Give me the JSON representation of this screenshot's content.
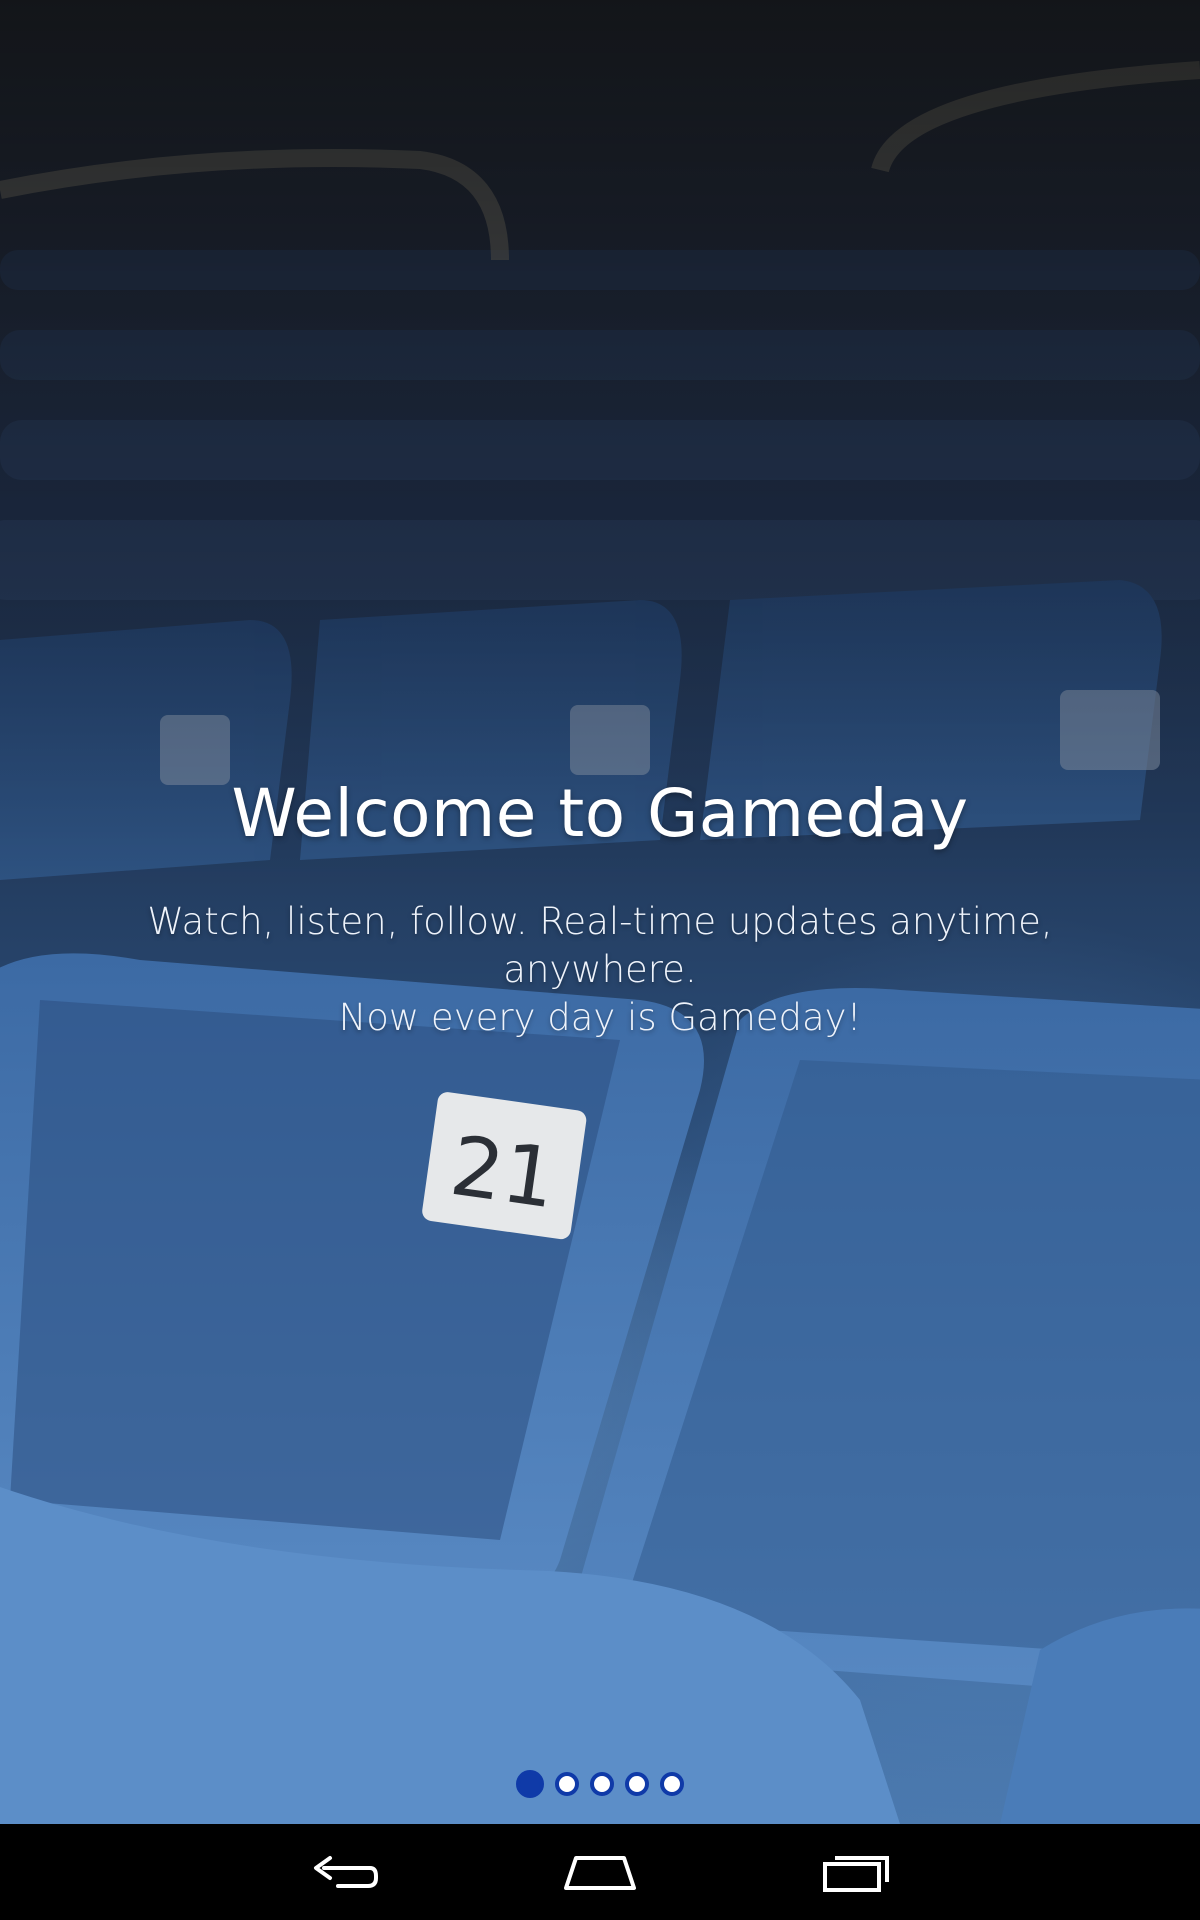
{
  "welcome": {
    "title": "Welcome to Gameday",
    "subtitle_line1": "Watch, listen, follow. Real-time updates anytime, anywhere.",
    "subtitle_line2": "Now every day is Gameday!"
  },
  "background": {
    "seat_number": "21"
  },
  "pager": {
    "total_pages": 5,
    "current_page": 1,
    "active_color": "#0f3aa8",
    "inactive_color": "#ffffff"
  },
  "navbar": {
    "buttons": [
      {
        "name": "back",
        "icon": "back-icon"
      },
      {
        "name": "home",
        "icon": "home-icon"
      },
      {
        "name": "recents",
        "icon": "recent-apps-icon"
      }
    ]
  }
}
